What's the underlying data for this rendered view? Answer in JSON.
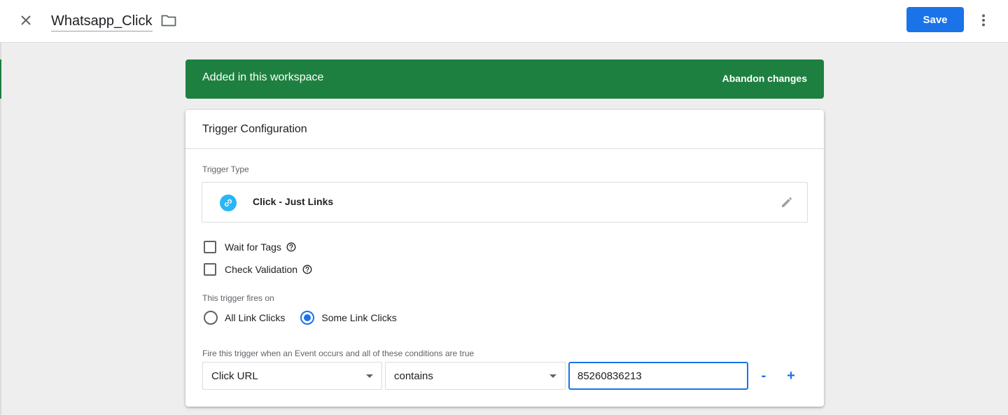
{
  "header": {
    "title": "Whatsapp_Click",
    "save_label": "Save"
  },
  "banner": {
    "text": "Added in this workspace",
    "action_label": "Abandon changes",
    "color": "#1e8040"
  },
  "config": {
    "heading": "Trigger Configuration",
    "trigger_type_label": "Trigger Type",
    "trigger_type_name": "Click - Just Links",
    "trigger_type_icon": "link-icon",
    "options": [
      {
        "label": "Wait for Tags",
        "checked": false
      },
      {
        "label": "Check Validation",
        "checked": false
      }
    ],
    "fires_on_label": "This trigger fires on",
    "fires_on_options": [
      {
        "label": "All Link Clicks",
        "selected": false
      },
      {
        "label": "Some Link Clicks",
        "selected": true
      }
    ],
    "conditions_label": "Fire this trigger when an Event occurs and all of these conditions are true",
    "condition": {
      "variable": "Click URL",
      "operator": "contains",
      "value": "85260836213"
    },
    "remove_label": "-",
    "add_label": "+"
  },
  "colors": {
    "accent": "#1a73e8",
    "banner": "#1e8040",
    "link_icon_bg": "#29b6f6"
  }
}
